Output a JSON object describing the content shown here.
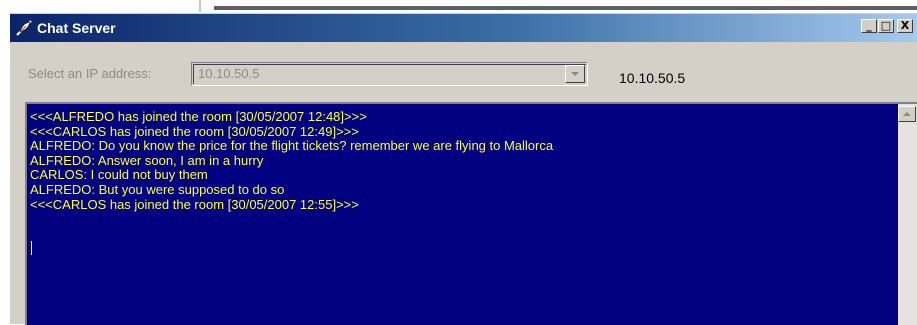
{
  "window": {
    "title": "Chat Server",
    "minimize_glyph": "_",
    "maximize_glyph": "□",
    "close_glyph": "X"
  },
  "ip": {
    "label": "Select an IP address:",
    "selected": "10.10.50.5",
    "current_display": "10.10.50.5"
  },
  "chat": {
    "lines": [
      "<<<ALFREDO has joined the room [30/05/2007 12:48]>>>",
      "<<<CARLOS has joined the room [30/05/2007 12:49]>>>",
      "ALFREDO: Do you know the price for the flight tickets? remember we are flying to Mallorca",
      "ALFREDO: Answer soon, I am in a hurry",
      "CARLOS: I could not buy them",
      "ALFREDO: But you were supposed to do so",
      "<<<CARLOS has joined the room [30/05/2007 12:55]>>>"
    ],
    "text_color": "#ffff33",
    "background": "#000080"
  },
  "colors": {
    "titlebar_start": "#0a246a",
    "titlebar_end": "#a6caf0",
    "face": "#d4d0c8"
  }
}
